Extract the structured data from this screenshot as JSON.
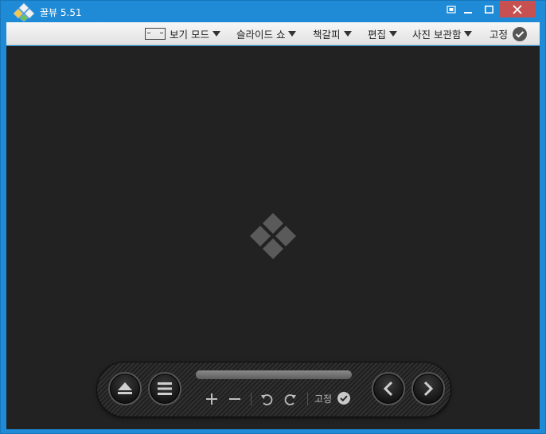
{
  "window": {
    "title": "꿀뷰 5.51",
    "colors": {
      "titlebar": "#1f8ad6",
      "close": "#c75050",
      "viewer_bg": "#222222"
    }
  },
  "menubar": {
    "items": [
      {
        "label": "보기 모드",
        "icon": "viewmode-icon",
        "has_dropdown": true
      },
      {
        "label": "슬라이드 쇼",
        "has_dropdown": true
      },
      {
        "label": "책갈피",
        "has_dropdown": true
      },
      {
        "label": "편집",
        "has_dropdown": true
      },
      {
        "label": "사진 보관함",
        "has_dropdown": true
      },
      {
        "label": "고정",
        "icon": "check-circle-icon",
        "has_dropdown": false
      }
    ]
  },
  "controlbar": {
    "buttons": [
      "eject-icon",
      "list-icon",
      "zoom-in-icon",
      "zoom-out-icon",
      "rotate-left-icon",
      "rotate-right-icon",
      "prev-icon",
      "next-icon"
    ],
    "pin_label": "고정"
  }
}
